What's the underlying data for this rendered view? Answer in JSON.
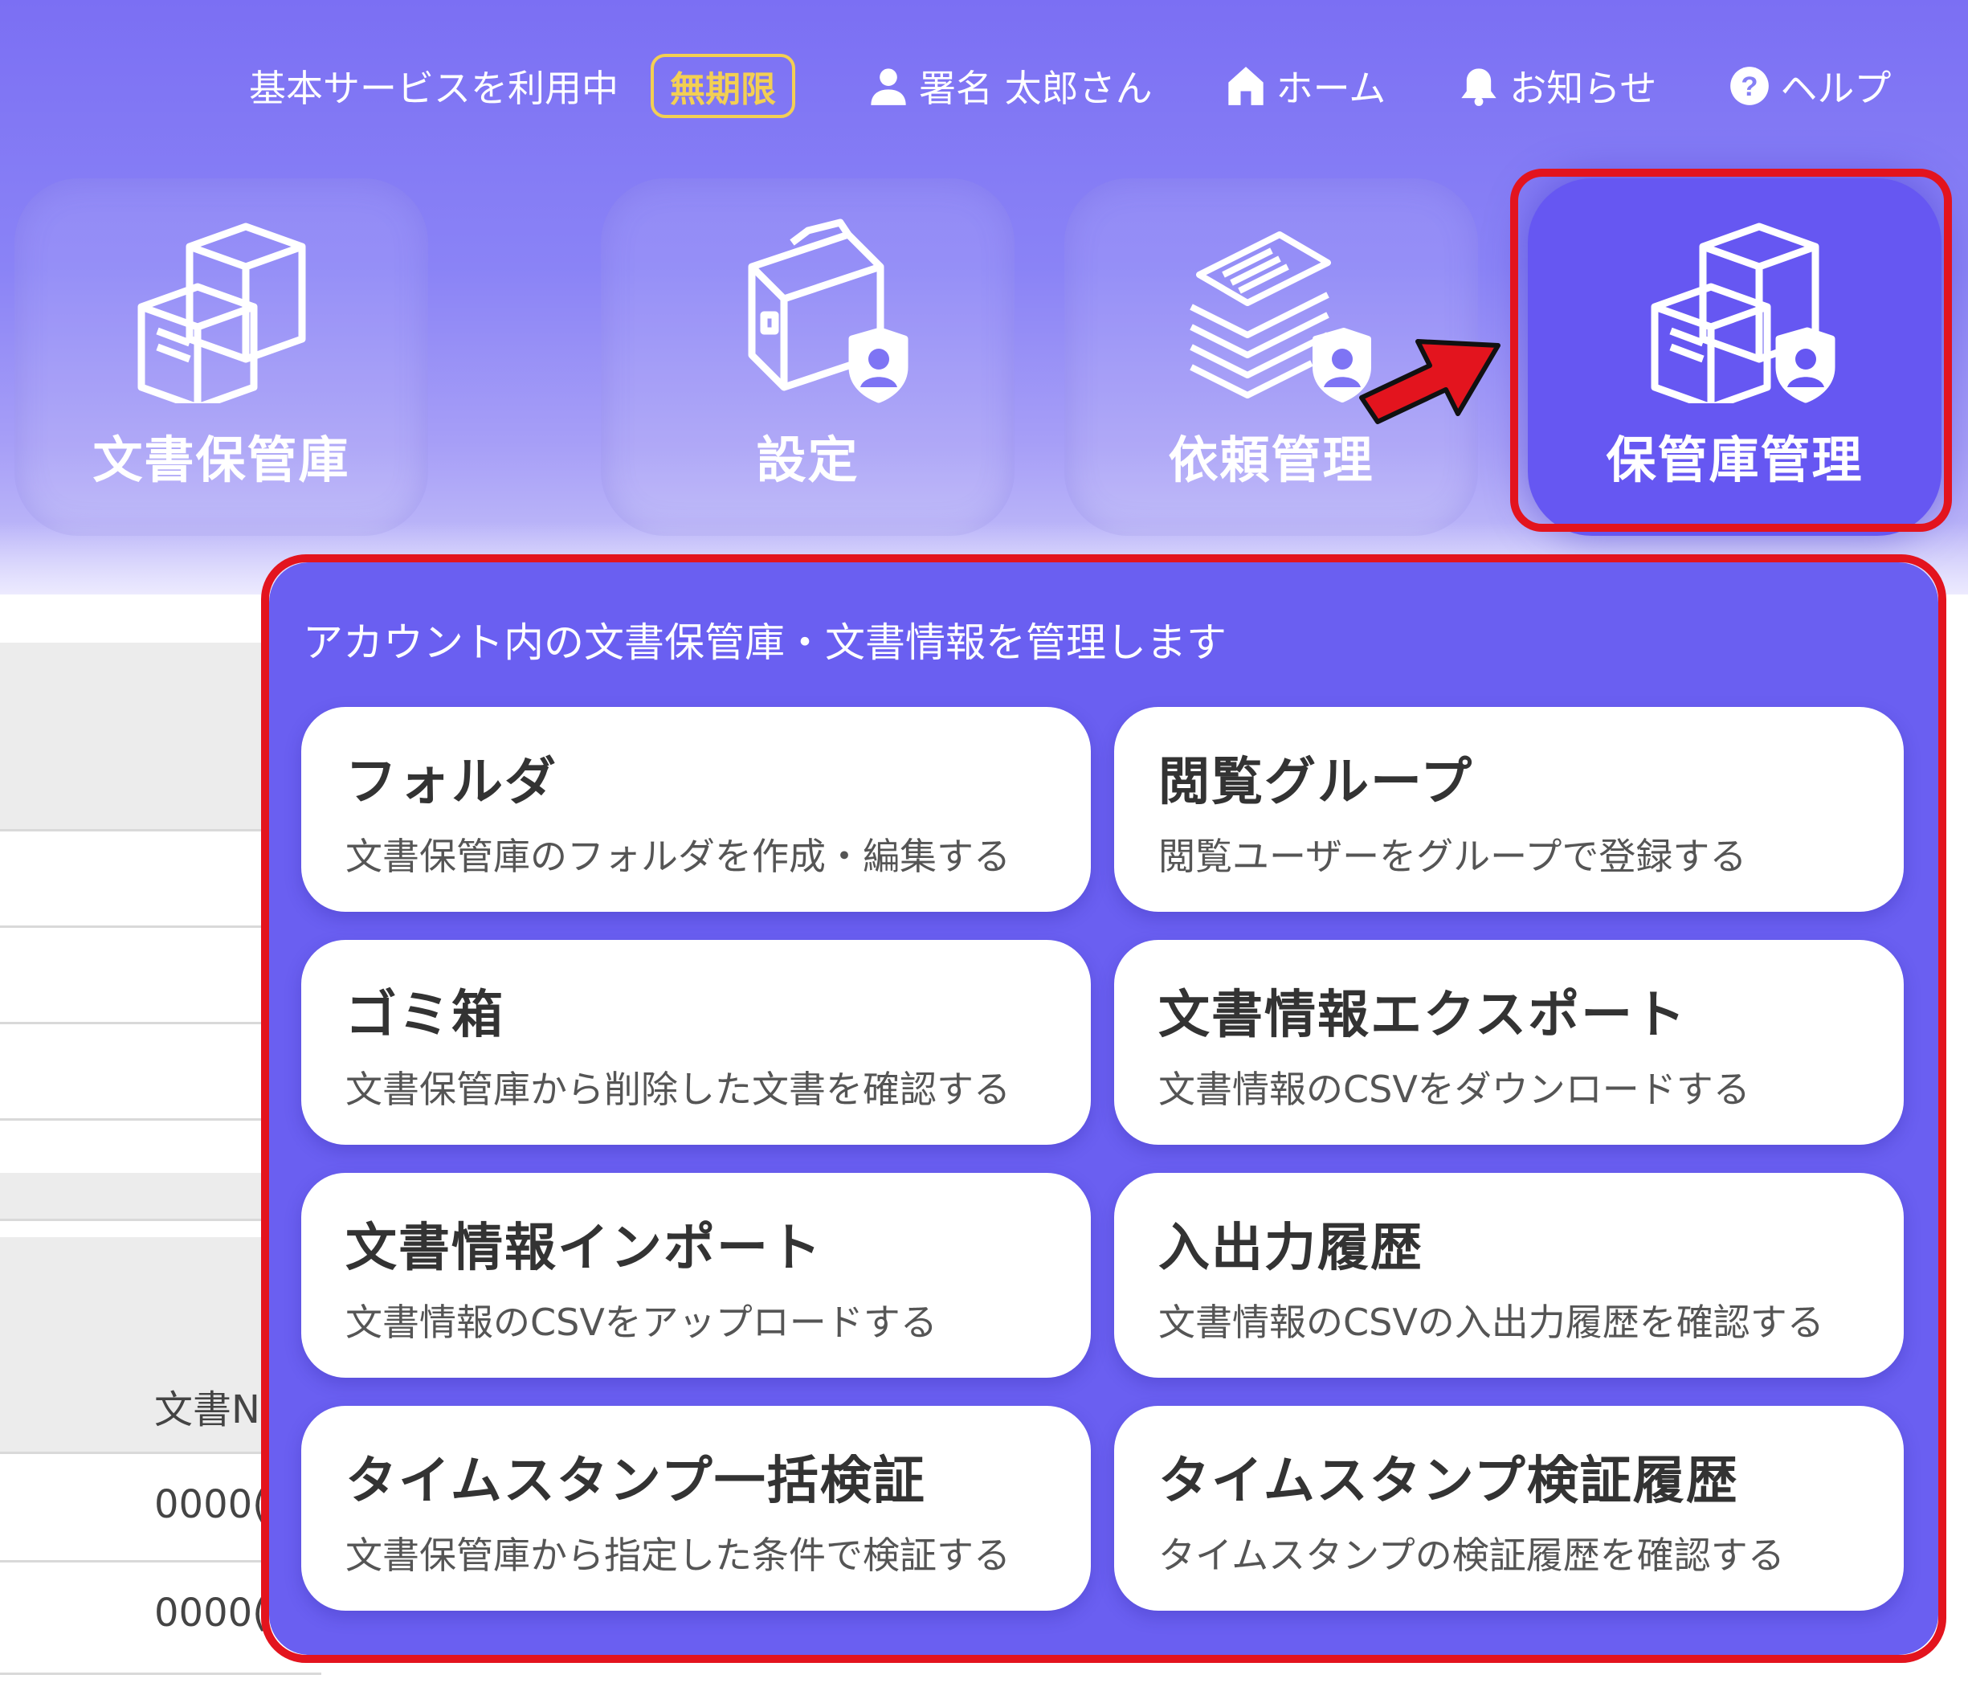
{
  "topbar": {
    "service_label": "基本サービスを利用中",
    "badge": "無期限",
    "user": "署名 太郎さん",
    "home": "ホーム",
    "notice": "お知らせ",
    "help": "ヘルプ"
  },
  "tiles": [
    {
      "label": "文書保管庫",
      "icon": "storage-boxes-icon"
    },
    {
      "label": "設定",
      "icon": "toolbox-icon"
    },
    {
      "label": "依頼管理",
      "icon": "document-stack-icon"
    },
    {
      "label": "保管庫管理",
      "icon": "storage-admin-icon",
      "highlighted": true
    }
  ],
  "background_table": {
    "column_header": "文書N",
    "rows": [
      "0000(",
      "0000("
    ]
  },
  "dropdown": {
    "title": "アカウント内の文書保管庫・文書情報を管理します",
    "items": [
      {
        "title": "フォルダ",
        "desc": "文書保管庫のフォルダを作成・編集する"
      },
      {
        "title": "閲覧グループ",
        "desc": "閲覧ユーザーをグループで登録する"
      },
      {
        "title": "ゴミ箱",
        "desc": "文書保管庫から削除した文書を確認する"
      },
      {
        "title": "文書情報エクスポート",
        "desc": "文書情報のCSVをダウンロードする"
      },
      {
        "title": "文書情報インポート",
        "desc": "文書情報のCSVをアップロードする"
      },
      {
        "title": "入出力履歴",
        "desc": "文書情報のCSVの入出力履歴を確認する"
      },
      {
        "title": "タイムスタンプ一括検証",
        "desc": "文書保管庫から指定した条件で検証する"
      },
      {
        "title": "タイムスタンプ検証履歴",
        "desc": "タイムスタンプの検証履歴を確認する"
      }
    ]
  },
  "colors": {
    "header_gradient_top": "#7b6ff3",
    "panel_bg": "#6a5ff1",
    "highlight": "#e3141e",
    "badge": "#f3cf53"
  }
}
